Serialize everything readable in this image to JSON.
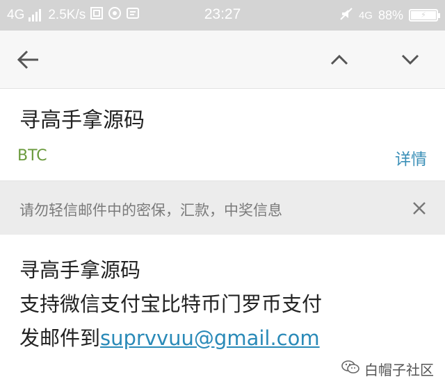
{
  "status_bar": {
    "network": "4G",
    "speed": "2.5K/s",
    "time": "23:27",
    "network_right": "4G",
    "battery": "88%"
  },
  "icons": {
    "back": "arrow-left-icon",
    "up": "chevron-up-icon",
    "down": "chevron-down-icon",
    "close": "close-icon"
  },
  "email": {
    "subject": "寻高手拿源码",
    "sender": "BTC",
    "details_label": "详情",
    "warning": "请勿轻信邮件中的密保，汇款，中奖信息",
    "body": {
      "line1": "寻高手拿源码",
      "line2": "支持微信支付宝比特币门罗币支付",
      "line3_prefix": "发邮件到",
      "line3_email": "suprvvuu@gmail.com"
    }
  },
  "watermark": {
    "label": "白帽子社区"
  },
  "colors": {
    "status_bar_bg": "#d4d4d4",
    "toolbar_bg": "#f7f7f7",
    "sender_green": "#6a9a3c",
    "link_blue": "#3a8fb7",
    "warning_bg": "#ececec"
  }
}
